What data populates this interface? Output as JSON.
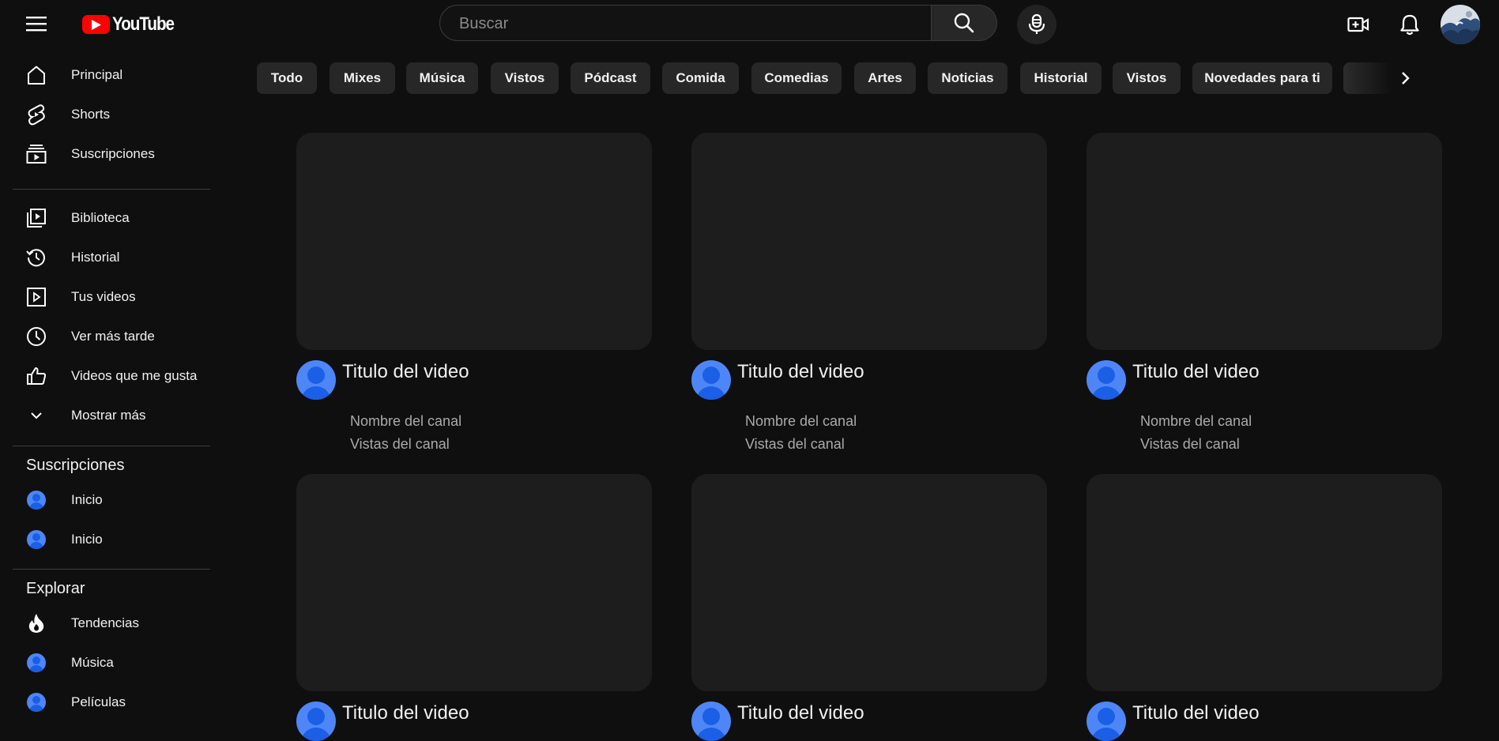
{
  "header": {
    "logo_text": "YouTube",
    "search": {
      "placeholder": "Buscar",
      "value": ""
    },
    "icons": [
      "menu-icon",
      "youtube-logo",
      "search-icon",
      "mic-icon",
      "create-video-icon",
      "bell-icon",
      "account-avatar"
    ]
  },
  "sidebar": {
    "main_items": [
      {
        "label": "Principal",
        "icon": "home-icon"
      },
      {
        "label": "Shorts",
        "icon": "shorts-icon"
      },
      {
        "label": "Suscripciones",
        "icon": "subscriptions-icon"
      }
    ],
    "library_items": [
      {
        "label": "Biblioteca",
        "icon": "library-icon"
      },
      {
        "label": "Historial",
        "icon": "history-icon"
      },
      {
        "label": "Tus videos",
        "icon": "your-videos-icon"
      },
      {
        "label": "Ver más tarde",
        "icon": "clock-icon"
      },
      {
        "label": "Videos que me gusta",
        "icon": "thumbs-up-icon"
      },
      {
        "label": "Mostrar más",
        "icon": "chevron-down-icon"
      }
    ],
    "subscriptions_heading": "Suscripciones",
    "subscriptions": [
      {
        "label": "Inicio",
        "icon": "channel-avatar"
      },
      {
        "label": "Inicio",
        "icon": "channel-avatar"
      }
    ],
    "explore_heading": "Explorar",
    "explore_items": [
      {
        "label": "Tendencias",
        "icon": "fire-icon"
      },
      {
        "label": "Música",
        "icon": "channel-avatar"
      },
      {
        "label": "Películas",
        "icon": "channel-avatar"
      }
    ]
  },
  "chips": [
    "Todo",
    "Mixes",
    "Música",
    "Vistos",
    "Pódcast",
    "Comida",
    "Comedias",
    "Artes",
    "Noticias",
    "Historial",
    "Vistos",
    "Novedades para ti"
  ],
  "videos": [
    {
      "title": "Titulo del video",
      "channel": "Nombre del canal",
      "views": "Vistas del canal"
    },
    {
      "title": "Titulo del video",
      "channel": "Nombre del canal",
      "views": "Vistas del canal"
    },
    {
      "title": "Titulo del video",
      "channel": "Nombre del canal",
      "views": "Vistas del canal"
    },
    {
      "title": "Titulo del video",
      "channel": "",
      "views": ""
    },
    {
      "title": "Titulo del video",
      "channel": "",
      "views": ""
    },
    {
      "title": "Titulo del video",
      "channel": "",
      "views": ""
    }
  ],
  "colors": {
    "background": "#0f0f0f",
    "chip_background": "#272727",
    "thumbnail_placeholder": "#1d1d1d",
    "brand_red": "#ff0000",
    "avatar_blue": "#4f86f7"
  }
}
